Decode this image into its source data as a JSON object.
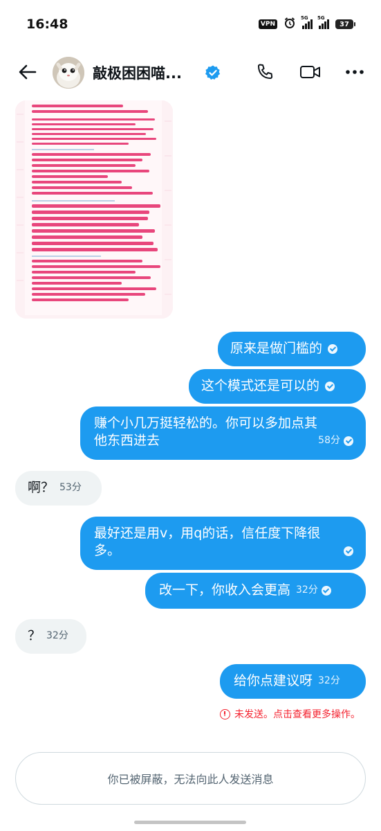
{
  "status_bar": {
    "time": "16:48",
    "vpn": "VPN",
    "signal_1": "5G",
    "signal_2": "5G",
    "battery": "37"
  },
  "header": {
    "back_icon": "arrow-left-icon",
    "name": "敲极困困喵...",
    "verified_icon": "verified-badge-icon",
    "verified_color": "#1d9bf0",
    "call_icon": "phone-icon",
    "video_icon": "video-camera-icon",
    "more_icon": "more-horizontal-icon"
  },
  "shared_image": {
    "type": "screenshot of pink text notes"
  },
  "messages": [
    {
      "direction": "out",
      "text": "原来是做门槛的",
      "time": "",
      "status": "sent"
    },
    {
      "direction": "out",
      "text": "这个模式还是可以的",
      "time": "",
      "status": "sent"
    },
    {
      "direction": "out",
      "line1": "赚个小几万挺轻松的。你可以多加点其",
      "line2": "他东西进去",
      "time": "58分",
      "status": "sent"
    },
    {
      "direction": "in",
      "text": "啊？",
      "time": "53分"
    },
    {
      "direction": "out",
      "line1": "最好还是用v，用q的话，信任度下降很",
      "line2": "多。",
      "time": "",
      "status": "sent"
    },
    {
      "direction": "out",
      "text": "改一下，你收入会更高",
      "time": "32分",
      "status": "sent"
    },
    {
      "direction": "in",
      "text": "？",
      "time": "32分"
    },
    {
      "direction": "out",
      "text": "给你点建议呀",
      "time": "32分",
      "status": "failed"
    }
  ],
  "failed_notice": "未发送。点击查看更多操作。",
  "blocked_notice": "你已被屏蔽，无法向此人发送消息",
  "colors": {
    "accent": "#1d9bf0",
    "incoming_bubble": "#eff3f4",
    "error": "#f4212e"
  }
}
